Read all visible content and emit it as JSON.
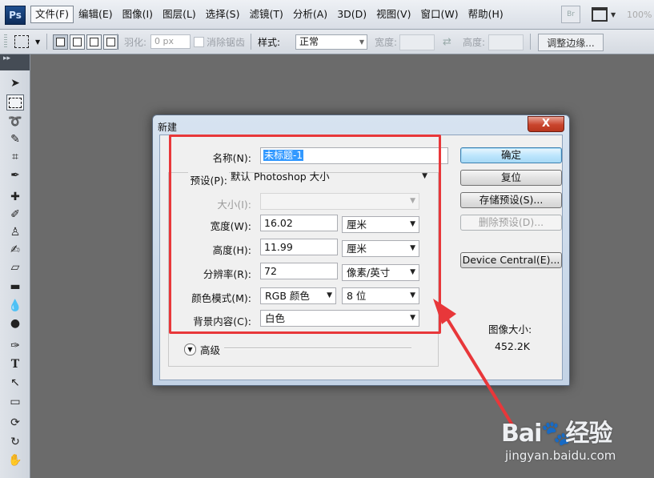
{
  "menubar": {
    "logo": "Ps",
    "items": [
      "文件(F)",
      "编辑(E)",
      "图像(I)",
      "图层(L)",
      "选择(S)",
      "滤镜(T)",
      "分析(A)",
      "3D(D)",
      "视图(V)",
      "窗口(W)",
      "帮助(H)"
    ],
    "bridge_label": "Br",
    "zoom": "100%"
  },
  "options": {
    "feather_label": "羽化:",
    "feather_value": "0 px",
    "antialias_label": "消除锯齿",
    "style_label": "样式:",
    "style_value": "正常",
    "width_label": "宽度:",
    "height_label": "高度:",
    "refine_label": "调整边缘..."
  },
  "dialog": {
    "title": "新建",
    "close": "X",
    "name_label": "名称(N):",
    "name_value": "未标题-1",
    "preset_label": "预设(P):",
    "preset_value": "默认 Photoshop 大小",
    "size_label": "大小(I):",
    "width_label": "宽度(W):",
    "width_value": "16.02",
    "width_unit": "厘米",
    "height_label": "高度(H):",
    "height_value": "11.99",
    "height_unit": "厘米",
    "resolution_label": "分辨率(R):",
    "resolution_value": "72",
    "resolution_unit": "像素/英寸",
    "color_mode_label": "颜色模式(M):",
    "color_mode_value": "RGB 颜色",
    "bit_depth_value": "8 位",
    "background_label": "背景内容(C):",
    "background_value": "白色",
    "advanced_label": "高级",
    "ok_label": "确定",
    "reset_label": "复位",
    "save_preset_label": "存储预设(S)...",
    "delete_preset_label": "删除预设(D)...",
    "device_central_label": "Device Central(E)...",
    "image_size_label": "图像大小:",
    "image_size_value": "452.2K"
  },
  "watermark": {
    "logo_text_a": "Bai",
    "logo_text_b": "经验",
    "url": "jingyan.baidu.com"
  },
  "colors": {
    "highlight": "#e8373a",
    "workspace": "#6b6b6b"
  }
}
